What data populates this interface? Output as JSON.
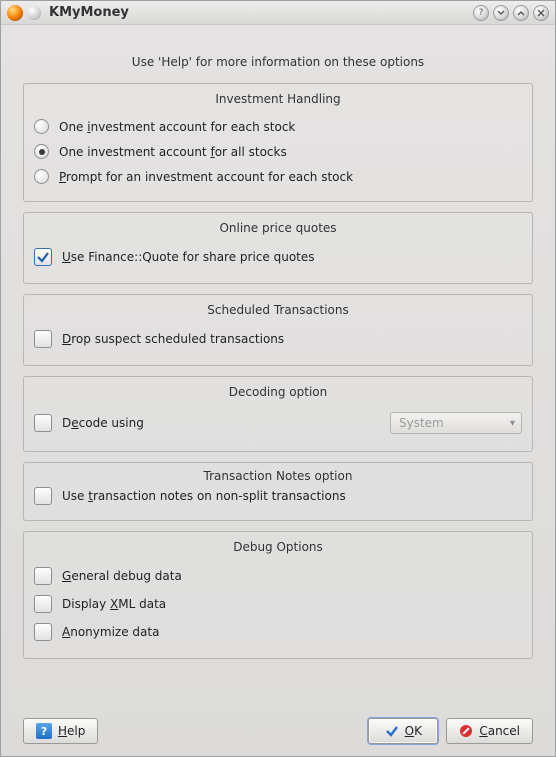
{
  "window": {
    "title": "KMyMoney"
  },
  "hint": "Use 'Help' for more information on these options",
  "groups": {
    "investment": {
      "title": "Investment Handling",
      "opt_each": "One investment account for each stock",
      "opt_all": "One investment account for all stocks",
      "opt_prompt": "Prompt for an investment account for each stock",
      "selected": "all"
    },
    "quotes": {
      "title": "Online price quotes",
      "use_finance_quote": "Use Finance::Quote for share price quotes",
      "checked": true
    },
    "scheduled": {
      "title": "Scheduled Transactions",
      "drop_suspect": "Drop suspect scheduled transactions",
      "checked": false
    },
    "decoding": {
      "title": "Decoding option",
      "decode_using": "Decode using",
      "checked": false,
      "combo_value": "System"
    },
    "notes": {
      "title": "Transaction Notes option",
      "use_notes": "Use transaction notes on non-split transactions",
      "checked": false
    },
    "debug": {
      "title": "Debug Options",
      "general": "General debug data",
      "xml": "Display XML data",
      "anon": "Anonymize data",
      "general_checked": false,
      "xml_checked": false,
      "anon_checked": false
    }
  },
  "buttons": {
    "help": "Help",
    "ok": "OK",
    "cancel": "Cancel"
  }
}
